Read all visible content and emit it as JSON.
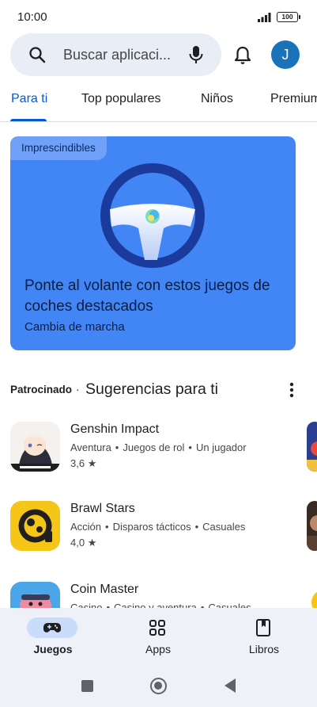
{
  "status_bar": {
    "time": "10:00",
    "battery": "100"
  },
  "search": {
    "placeholder": "Buscar aplicaci..."
  },
  "account": {
    "initial": "J"
  },
  "tabs": [
    {
      "label": "Para ti",
      "active": true
    },
    {
      "label": "Top populares",
      "active": false
    },
    {
      "label": "Niños",
      "active": false
    },
    {
      "label": "Premium",
      "active": false
    }
  ],
  "banner": {
    "tag": "Imprescindibles",
    "title": "Ponte al volante con estos juegos de coches destacados",
    "subtitle": "Cambia de marcha"
  },
  "section": {
    "sponsored": "Patrocinado",
    "separator": "·",
    "title": "Sugerencias para ti"
  },
  "apps": [
    {
      "name": "Genshin Impact",
      "tags": [
        "Aventura",
        "Juegos de rol",
        "Un jugador"
      ],
      "rating": "3,6",
      "icon": "genshin-icon"
    },
    {
      "name": "Brawl Stars",
      "tags": [
        "Acción",
        "Disparos tácticos",
        "Casuales"
      ],
      "rating": "4,0",
      "icon": "brawl-stars-icon"
    },
    {
      "name": "Coin Master",
      "tags": [
        "Casino",
        "Casino y aventura",
        "Casuales"
      ],
      "rating": "",
      "icon": "coin-master-icon"
    }
  ],
  "bottom_nav": [
    {
      "label": "Juegos",
      "icon": "gamepad-icon",
      "active": true
    },
    {
      "label": "Apps",
      "icon": "apps-grid-icon",
      "active": false
    },
    {
      "label": "Libros",
      "icon": "bookmark-icon",
      "active": false
    }
  ],
  "colors": {
    "accent": "#0b57d0",
    "banner": "#4285f4",
    "avatar": "#1a73b8",
    "nav_background": "#eef2f8"
  }
}
